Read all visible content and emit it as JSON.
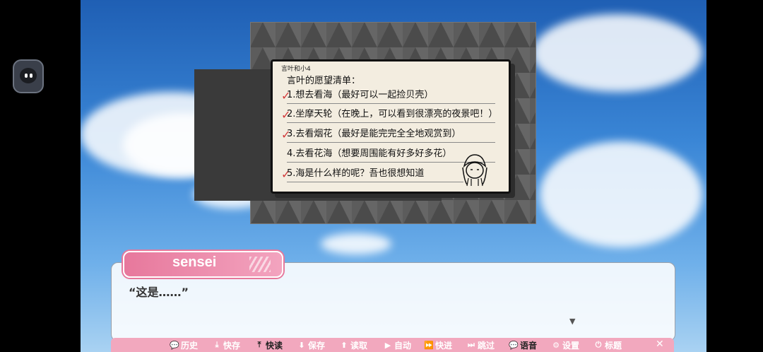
{
  "dialog": {
    "speaker": "sensei",
    "text": "“这是……”",
    "advance_icon": "triangle-down-icon"
  },
  "note": {
    "tiny_title": "言叶和小4",
    "heading": "言叶的愿望清单：",
    "items": [
      "1.想去看海（最好可以一起捡贝壳）",
      "2.坐摩天轮（在晚上，可以看到很漂亮的夜景吧！）",
      "3.去看烟花（最好是能完完全全地观赏到）",
      "4.去看花海（想要周围能有好多好多花）",
      "5.海是什么样的呢？吾也很想知道"
    ]
  },
  "menu": [
    {
      "label": "历史",
      "icon": "chat-icon"
    },
    {
      "label": "快存",
      "icon": "download-icon"
    },
    {
      "label": "快读",
      "icon": "upload-icon"
    },
    {
      "label": "保存",
      "icon": "arrow-down-icon"
    },
    {
      "label": "读取",
      "icon": "arrow-up-icon"
    },
    {
      "label": "自动",
      "icon": "play-icon"
    },
    {
      "label": "快进",
      "icon": "fast-forward-icon"
    },
    {
      "label": "跳过",
      "icon": "skip-icon"
    },
    {
      "label": "语音",
      "icon": "speech-icon"
    },
    {
      "label": "设置",
      "icon": "gear-icon"
    },
    {
      "label": "标题",
      "icon": "power-icon"
    }
  ],
  "close_label": "✕",
  "colors": {
    "accent": "#e7789c",
    "menubar": "#f2a8be",
    "sky": "#3a86d6"
  }
}
